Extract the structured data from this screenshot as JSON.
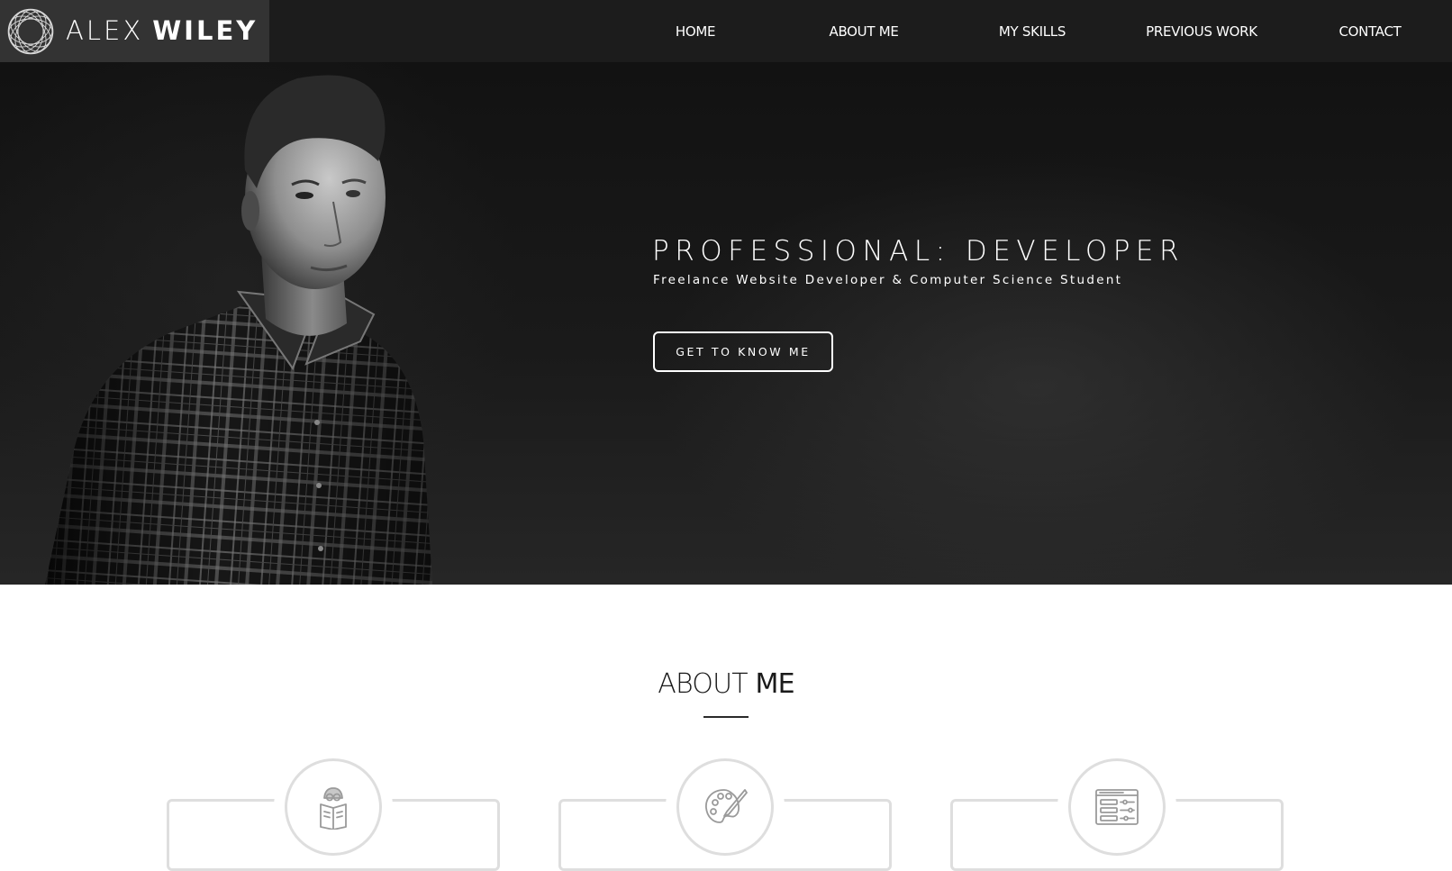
{
  "brand": {
    "first_name": "ALEX",
    "last_name": "WILEY",
    "logo_icon": "circular-weave-logo-icon"
  },
  "nav": {
    "items": [
      {
        "label": "HOME"
      },
      {
        "label": "ABOUT ME"
      },
      {
        "label": "MY SKILLS"
      },
      {
        "label": "PREVIOUS WORK"
      },
      {
        "label": "CONTACT"
      }
    ]
  },
  "hero": {
    "title": "PROFESSIONAL: DEVELOPER",
    "subtitle": "Freelance Website Developer & Computer Science Student",
    "button_label": "GET TO KNOW ME",
    "photo": "black-and-white-portrait-photo"
  },
  "about": {
    "heading_light": "ABOUT",
    "heading_bold": "ME",
    "cards": [
      {
        "icon": "reading-student-icon"
      },
      {
        "icon": "paint-palette-icon"
      },
      {
        "icon": "settings-panel-icon"
      }
    ]
  },
  "colors": {
    "nav_background": "#1c1c1c",
    "brand_background": "#333333",
    "hero_text": "#ffffff",
    "card_border": "#dedede"
  }
}
